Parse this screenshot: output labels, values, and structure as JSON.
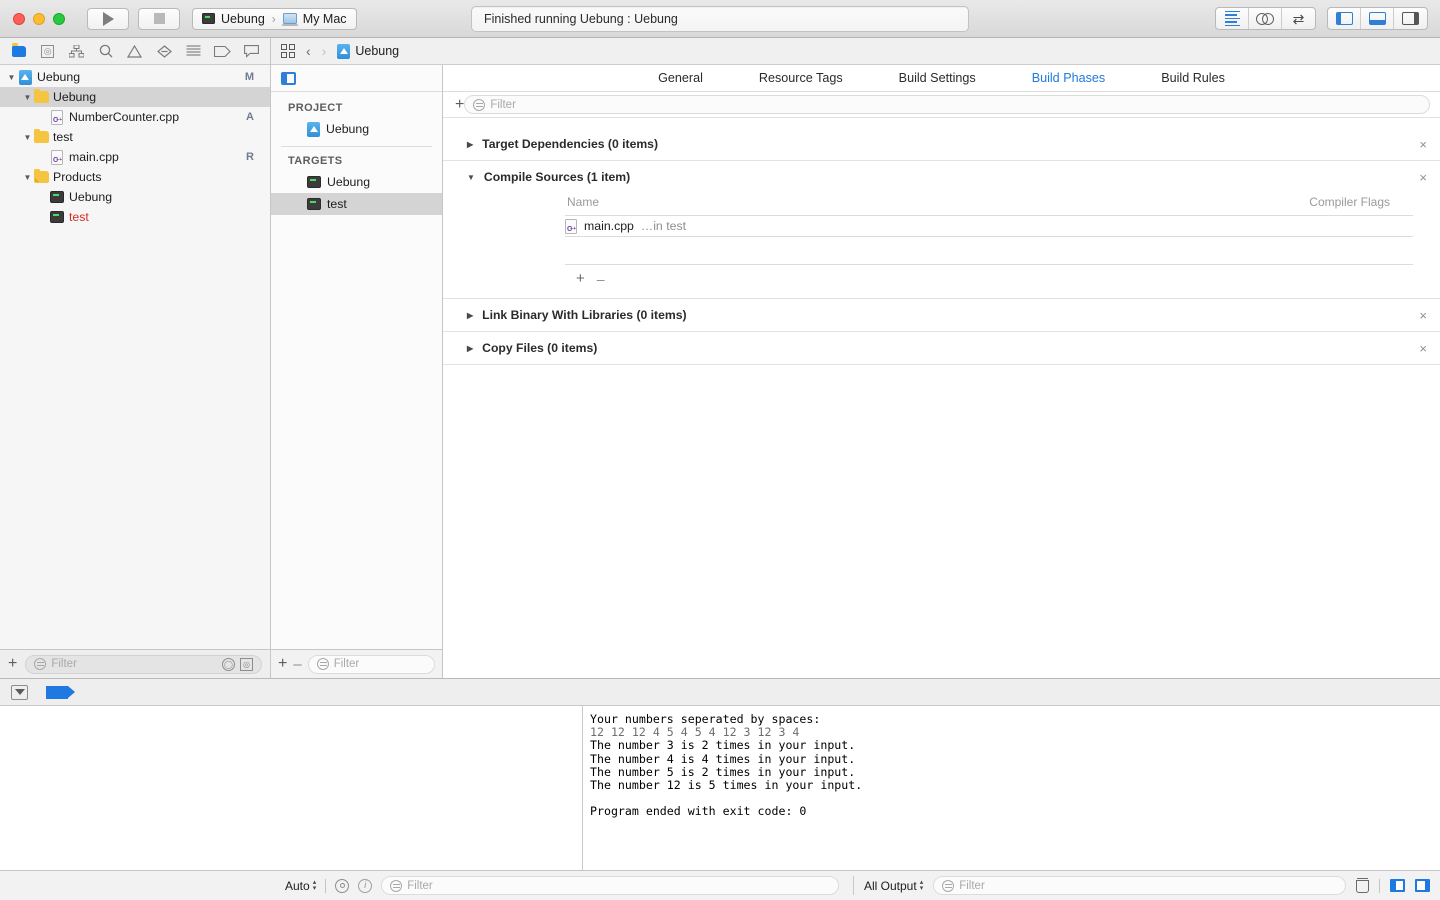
{
  "titlebar": {
    "run_icon": "play-icon",
    "stop_icon": "stop-icon",
    "scheme_name": "Uebung",
    "scheme_separator": "›",
    "destination": "My Mac",
    "status": "Finished running Uebung : Uebung",
    "editor_modes": [
      "standard-editor-icon",
      "assistant-editor-icon",
      "version-editor-icon"
    ],
    "view_toggles": [
      "navigator-toggle-icon",
      "debug-area-toggle-icon",
      "inspector-toggle-icon"
    ]
  },
  "navigator": {
    "tabs": [
      "project-navigator-icon",
      "source-control-navigator-icon",
      "symbol-navigator-icon",
      "find-navigator-icon",
      "issue-navigator-icon",
      "test-navigator-icon",
      "debug-navigator-icon",
      "breakpoint-navigator-icon",
      "report-navigator-icon"
    ],
    "tree": [
      {
        "label": "Uebung",
        "icon": "xcodeproj-icon",
        "indent": 0,
        "twisty": "open",
        "status": "M",
        "selected": false
      },
      {
        "label": "Uebung",
        "icon": "folder-icon",
        "indent": 1,
        "twisty": "open",
        "status": "",
        "selected": true
      },
      {
        "label": "NumberCounter.cpp",
        "icon": "cpp-file-icon",
        "indent": 2,
        "twisty": "none",
        "status": "A",
        "selected": false
      },
      {
        "label": "test",
        "icon": "folder-icon",
        "indent": 1,
        "twisty": "open",
        "status": "",
        "selected": false
      },
      {
        "label": "main.cpp",
        "icon": "cpp-file-icon",
        "indent": 2,
        "twisty": "none",
        "status": "R",
        "selected": false
      },
      {
        "label": "Products",
        "icon": "products-folder-icon",
        "indent": 1,
        "twisty": "open",
        "status": "",
        "selected": false
      },
      {
        "label": "Uebung",
        "icon": "executable-icon",
        "indent": 2,
        "twisty": "none",
        "status": "",
        "selected": false
      },
      {
        "label": "test",
        "icon": "executable-icon",
        "indent": 2,
        "twisty": "none",
        "status": "",
        "selected": false,
        "missing": true
      }
    ],
    "bottom": {
      "add_label": "+",
      "filter_placeholder": "Filter",
      "recent_icon": "clock-icon",
      "scm_icon": "source-control-icon"
    }
  },
  "jumpbar": {
    "related_icon": "related-items-icon",
    "back_icon": "chevron-left-icon",
    "forward_icon": "chevron-right-icon",
    "file_icon": "xcodeproj-icon",
    "file_name": "Uebung"
  },
  "project_sidebar": {
    "toggle_icon": "project-list-toggle-icon",
    "project_header": "PROJECT",
    "projects": [
      {
        "label": "Uebung",
        "icon": "xcodeproj-icon",
        "selected": false
      }
    ],
    "targets_header": "TARGETS",
    "targets": [
      {
        "label": "Uebung",
        "icon": "executable-icon",
        "selected": false
      },
      {
        "label": "test",
        "icon": "executable-icon",
        "selected": true
      }
    ],
    "bottom": {
      "add_label": "+",
      "remove_label": "–",
      "filter_placeholder": "Filter"
    }
  },
  "editor": {
    "tabs": [
      {
        "label": "General",
        "active": false
      },
      {
        "label": "Resource Tags",
        "active": false
      },
      {
        "label": "Build Settings",
        "active": false
      },
      {
        "label": "Build Phases",
        "active": true
      },
      {
        "label": "Build Rules",
        "active": false
      }
    ],
    "toolbar": {
      "add_label": "+",
      "filter_placeholder": "Filter"
    },
    "phases": [
      {
        "title": "Target Dependencies (0 items)",
        "expanded": false,
        "close_label": "×",
        "columns": [],
        "files": []
      },
      {
        "title": "Compile Sources (1 item)",
        "expanded": true,
        "close_label": "×",
        "columns": {
          "name": "Name",
          "flags": "Compiler Flags"
        },
        "files": [
          {
            "name": "main.cpp",
            "location": "…in test",
            "icon": "cpp-file-icon"
          }
        ],
        "add_label": "+",
        "remove_label": "–"
      },
      {
        "title": "Link Binary With Libraries (0 items)",
        "expanded": false,
        "close_label": "×",
        "columns": [],
        "files": []
      },
      {
        "title": "Copy Files (0 items)",
        "expanded": false,
        "close_label": "×",
        "columns": [],
        "files": []
      }
    ]
  },
  "debug_area": {
    "filter_icon": "debug-filter-icon",
    "breakpoints_icon": "breakpoints-active-icon",
    "console_lines": [
      {
        "text": "Your numbers seperated by spaces:",
        "kind": "output"
      },
      {
        "text": "12 12 12 4 5 4 5 4 12 3 12 3 4",
        "kind": "input"
      },
      {
        "text": "The number 3 is 2 times in your input.",
        "kind": "output"
      },
      {
        "text": "The number 4 is 4 times in your input.",
        "kind": "output"
      },
      {
        "text": "The number 5 is 2 times in your input.",
        "kind": "output"
      },
      {
        "text": "The number 12 is 5 times in your input.",
        "kind": "output"
      },
      {
        "text": "",
        "kind": "blank"
      },
      {
        "text": "Program ended with exit code: 0",
        "kind": "output"
      }
    ]
  },
  "bottom_bar": {
    "variables_scope": "Auto",
    "eye_icon": "watch-icon",
    "info_icon": "info-icon",
    "variables_filter_placeholder": "Filter",
    "console_scope": "All Output",
    "console_filter_placeholder": "Filter",
    "clear_icon": "trash-icon",
    "split_left_icon": "show-variables-icon",
    "split_right_icon": "show-console-icon"
  },
  "colors": {
    "accent": "#1e7ae0",
    "selection": "#d4d4d4",
    "missing_file": "#d42d1f",
    "chrome": "#f2f2f2"
  }
}
